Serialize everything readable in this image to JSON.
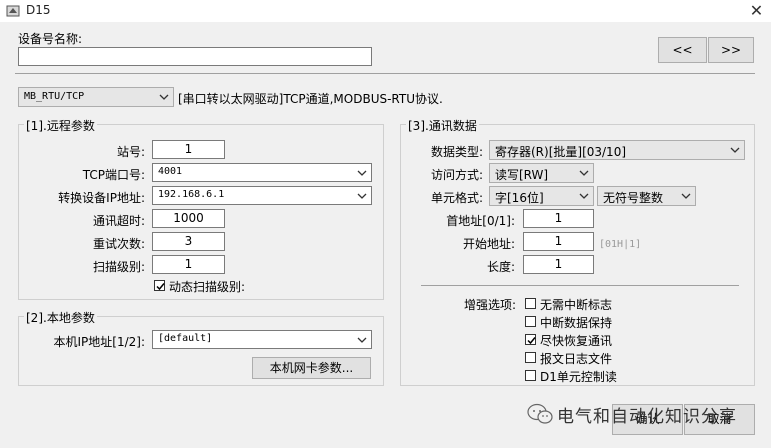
{
  "window": {
    "title": "D15",
    "icons": [
      "app-icon",
      "close-icon"
    ]
  },
  "device_name": {
    "label": "设备号名称:",
    "value": ""
  },
  "nav": {
    "prev_label": "<<",
    "next_label": ">>"
  },
  "protocol": {
    "value": "MB_RTU/TCP",
    "description": "[串口转以太网驱动]TCP通道,MODBUS-RTU协议."
  },
  "remote": {
    "title": "[1].远程参数",
    "station_label": "站号:",
    "station_value": "1",
    "tcp_port_label": "TCP端口号:",
    "tcp_port_value": "4001",
    "device_ip_label": "转换设备IP地址:",
    "device_ip_value": "192.168.6.1",
    "timeout_label": "通讯超时:",
    "timeout_value": "1000",
    "retry_label": "重试次数:",
    "retry_value": "3",
    "scan_label": "扫描级别:",
    "scan_value": "1",
    "dynamic_scan_label": "动态扫描级别:",
    "dynamic_scan_checked": true
  },
  "local": {
    "title": "[2].本地参数",
    "ip_label": "本机IP地址[1/2]:",
    "ip_value": "[default]",
    "nic_button": "本机网卡参数..."
  },
  "comm": {
    "title": "[3].通讯数据",
    "data_type_label": "数据类型:",
    "data_type_value": "寄存器(R)[批量][03/10]",
    "access_label": "访问方式:",
    "access_value": "读写[RW]",
    "unit_format_label": "单元格式:",
    "unit_format_value": "字[16位]",
    "sign_value": "无符号整数",
    "first_addr_label": "首地址[0/1]:",
    "first_addr_value": "1",
    "start_addr_label": "开始地址:",
    "start_addr_value": "1",
    "start_addr_hint": "[01H|1]",
    "length_label": "长度:",
    "length_value": "1",
    "enhance_label": "增强选项:",
    "options": [
      {
        "label": "无需中断标志",
        "checked": false
      },
      {
        "label": "中断数据保持",
        "checked": false
      },
      {
        "label": "尽快恢复通讯",
        "checked": true
      },
      {
        "label": "报文日志文件",
        "checked": false
      },
      {
        "label": "D1单元控制读",
        "checked": false
      }
    ]
  },
  "buttons": {
    "ok": "确认",
    "cancel": "取消"
  },
  "watermark": {
    "text": "电气和自动化知识分享"
  }
}
